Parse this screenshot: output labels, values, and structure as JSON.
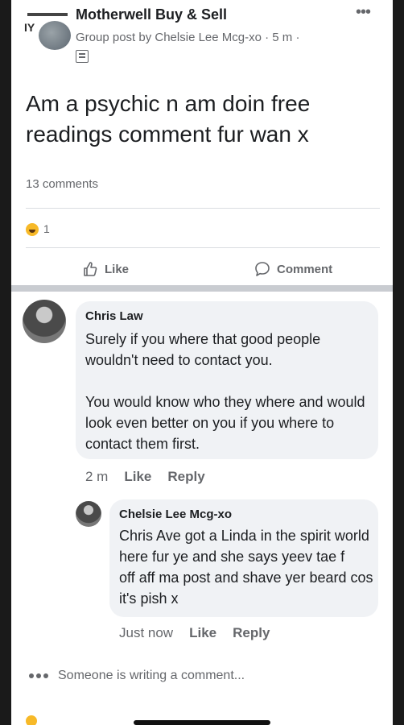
{
  "header": {
    "group_name": "Motherwell Buy & Sell",
    "subtitle": "Group post by Chelsie Lee Mcg-xo · 5 m ·",
    "group_avatar_text": "IY",
    "more_glyph": "•••"
  },
  "post": {
    "text": "Am a psychic n am doin free readings comment fur wan x",
    "comment_count": "13 comments",
    "reaction_count": "1"
  },
  "actions": {
    "like_label": "Like",
    "comment_label": "Comment"
  },
  "comments": [
    {
      "author": "Chris Law",
      "body_p1": "Surely if you where that good people wouldn't need to contact you.",
      "body_p2": "You would know who they where and would look even better on you if you where to contact them first.",
      "time": "2 m",
      "like": "Like",
      "reply": "Reply"
    },
    {
      "author": "Chelsie Lee Mcg-xo",
      "body": "Chris Ave got a Linda in the spirit world here fur ye and she says yeev tae f      off aff ma post and shave yer beard cos it's pish x",
      "time": "Just now",
      "like": "Like",
      "reply": "Reply"
    }
  ],
  "typing": {
    "text": "Someone is writing a comment..."
  },
  "icons": {
    "more": "more-options-icon",
    "privacy": "group-privacy-icon",
    "reaction": "haha-reaction-icon",
    "like": "thumbs-up-icon",
    "comment": "speech-bubble-icon",
    "typing": "typing-dots-icon"
  },
  "colors": {
    "text_primary": "#1c1e21",
    "text_secondary": "#65676b",
    "bubble_bg": "#f0f2f5",
    "reaction_yellow": "#f7b928"
  }
}
